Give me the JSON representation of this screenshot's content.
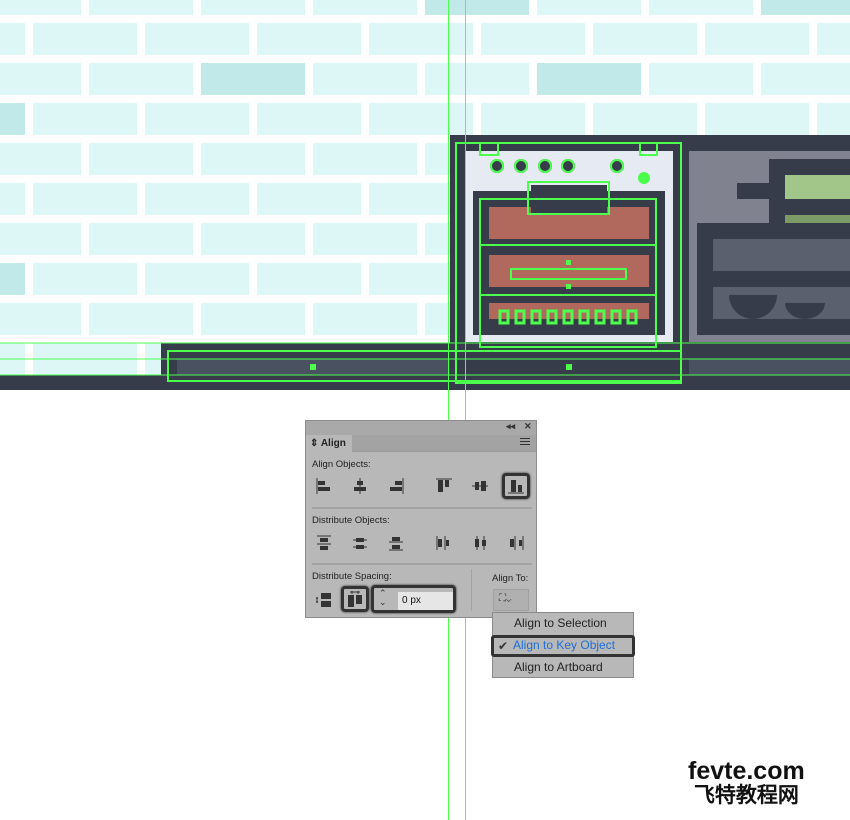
{
  "panel": {
    "title": "Align",
    "collapse_icon": "double-chevron-left-icon",
    "close_icon": "close-icon",
    "menu_icon": "hamburger-menu-icon",
    "align_objects_label": "Align Objects:",
    "align_objects_buttons": [
      "horizontal-align-left",
      "horizontal-align-center",
      "horizontal-align-right",
      "vertical-align-top",
      "vertical-align-center",
      "vertical-align-bottom"
    ],
    "distribute_objects_label": "Distribute Objects:",
    "distribute_objects_buttons": [
      "vertical-distribute-top",
      "vertical-distribute-center",
      "vertical-distribute-bottom",
      "horizontal-distribute-left",
      "horizontal-distribute-center",
      "horizontal-distribute-right"
    ],
    "distribute_spacing_label": "Distribute Spacing:",
    "spacing_value": "0 px",
    "align_to_label": "Align To:",
    "highlighted": [
      "vertical-align-bottom",
      "vertical-distribute-space",
      "spacing-input"
    ]
  },
  "dropdown": {
    "items": [
      {
        "label": "Align to Selection",
        "checked": false
      },
      {
        "label": "Align to Key Object",
        "checked": true
      },
      {
        "label": "Align to Artboard",
        "checked": false
      }
    ],
    "check_glyph": "✔"
  },
  "watermark": {
    "line1": "fevte.com",
    "line2": "飞特教程网"
  },
  "colors": {
    "guide": "#4cff4c",
    "brick": "#ddf7f7",
    "brick_dark": "#c1e9e9",
    "dark": "#373c4b",
    "selected_text": "#1e6fd9"
  }
}
